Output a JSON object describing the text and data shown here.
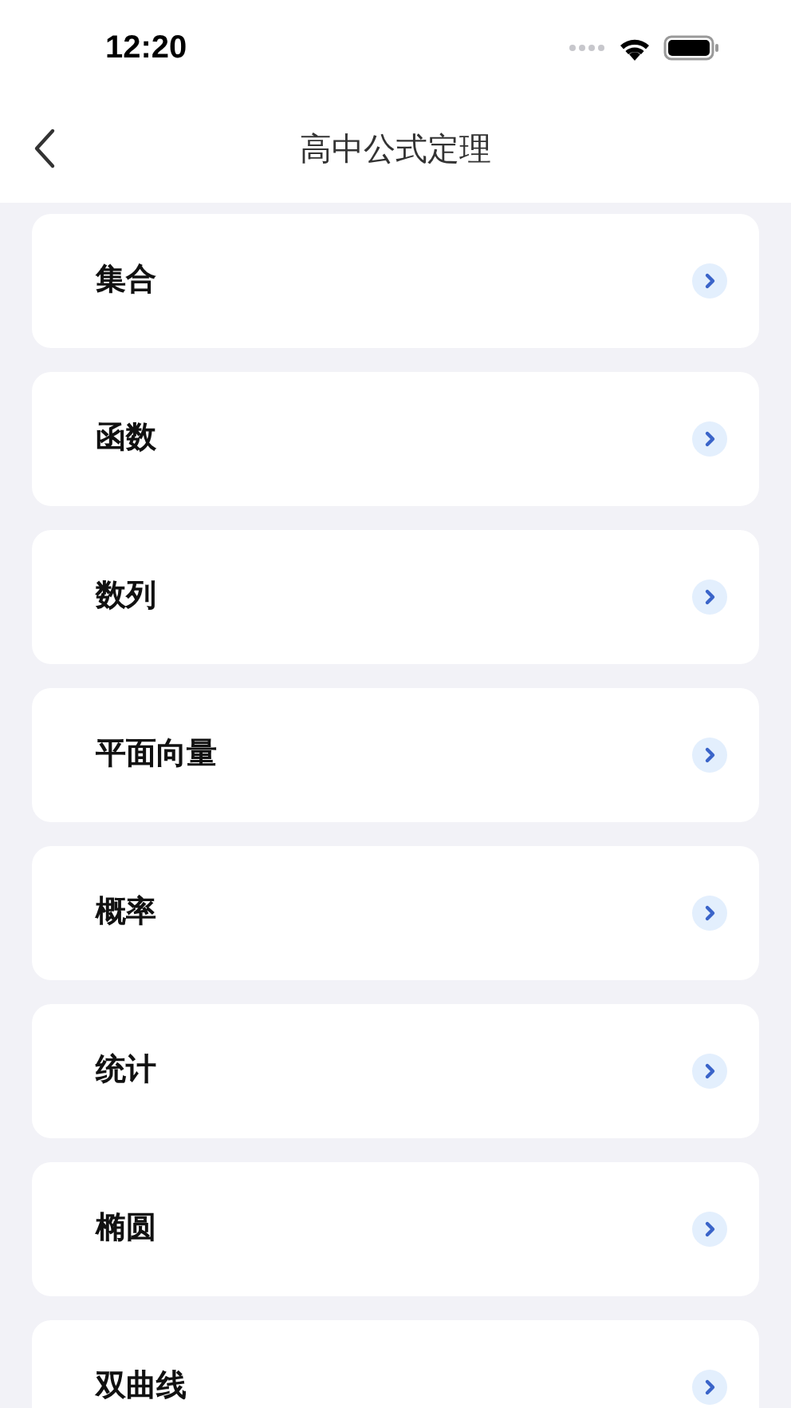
{
  "status_bar": {
    "time": "12:20"
  },
  "nav": {
    "title": "高中公式定理"
  },
  "items": [
    {
      "label": "集合"
    },
    {
      "label": "函数"
    },
    {
      "label": "数列"
    },
    {
      "label": "平面向量"
    },
    {
      "label": "概率"
    },
    {
      "label": "统计"
    },
    {
      "label": "椭圆"
    },
    {
      "label": "双曲线"
    }
  ]
}
